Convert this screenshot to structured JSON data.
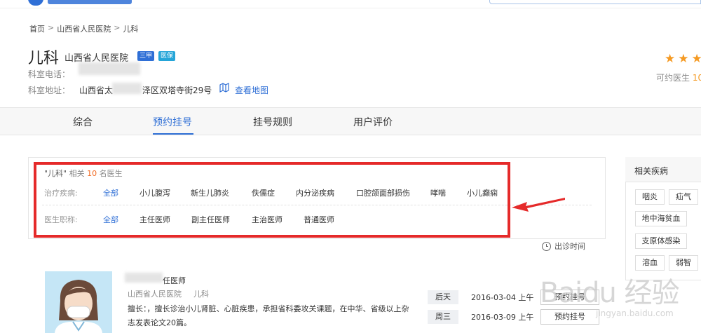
{
  "breadcrumb": [
    "首页",
    "山西省人民医院",
    "儿科"
  ],
  "breadcrumb_sep": ">",
  "header": {
    "dept": "儿科",
    "hospital": "山西省人民医院",
    "badges": [
      "三甲",
      "医保"
    ],
    "phone_label": "科室电话：",
    "address_label": "科室地址：",
    "address_prefix": "山西省太",
    "address_suffix": "泽区双塔寺街29号",
    "map_link": "查看地图"
  },
  "rating": {
    "stars": 3,
    "avail_label": "可约医生",
    "avail_num": "10"
  },
  "tabs": [
    "综合",
    "预约挂号",
    "挂号规则",
    "用户评价"
  ],
  "filter": {
    "related_prefix": "\"儿科\"",
    "related_mid": "相关",
    "related_count": "10",
    "related_suffix": "名医生",
    "disease_label": "治疗疾病:",
    "diseases": [
      "全部",
      "小儿腹泻",
      "新生儿肺炎",
      "佚儒症",
      "内分泌疾病",
      "口腔颌面部损伤",
      "哮喘",
      "小儿癫痫"
    ],
    "title_label": "医生职称:",
    "titles": [
      "全部",
      "主任医师",
      "副主任医师",
      "主治医师",
      "普通医师"
    ],
    "time_label": "出诊时间"
  },
  "sidebar": {
    "title": "相关疾病",
    "chips": [
      "咽炎",
      "疝气",
      "地中海贫血",
      "支原体感染",
      "溶血",
      "弱智"
    ]
  },
  "doctor": {
    "title_suffix": "任医师",
    "hospital": "山西省人民医院",
    "dept": "儿科",
    "desc": "擅长：，擅长诊治小儿肾脏、心脏疾患，承担省科委攻关课题，在中华、省级以上杂志发表论文20篇。",
    "schedule": [
      {
        "day": "后天",
        "date": "2016-03-04 上午",
        "btn": "预约挂号"
      },
      {
        "day": "周三",
        "date": "2016-03-09 上午",
        "btn": "预约挂号"
      }
    ]
  },
  "watermark": {
    "main": "Baidu 经验",
    "sub": "jingyan.baidu.com"
  },
  "colors": {
    "accent": "#2f6fd6",
    "highlight": "#e52a2a",
    "count": "#f26b23",
    "star": "#f59a23"
  }
}
